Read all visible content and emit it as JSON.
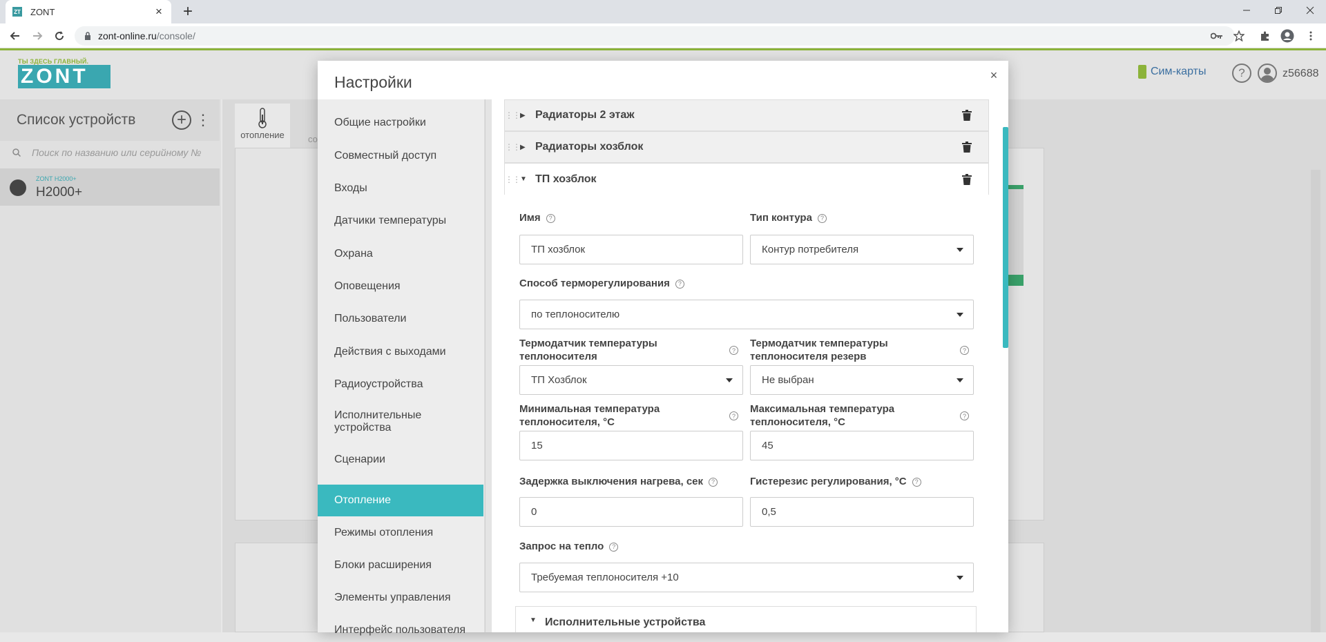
{
  "browser": {
    "tab_title": "ZONT",
    "favicon_text": "ZT",
    "url_host": "zont-online.ru",
    "url_path": "/console/"
  },
  "header": {
    "logo_tagline": "ТЫ ЗДЕСЬ ГЛАВНЫЙ.",
    "logo_text": "ZONT",
    "sim_label": "Сим-карты",
    "help_label": "?",
    "username": "z56688"
  },
  "left_panel": {
    "title": "Список устройств",
    "search_placeholder": "Поиск по названию или серийному №",
    "device_sub": "ZONT H2000+",
    "device_name": "H2000+"
  },
  "device_tab": {
    "label": "отопление",
    "next_label": "со"
  },
  "modal": {
    "title": "Настройки",
    "close": "×",
    "menu": [
      "Общие настройки",
      "Совместный доступ",
      "Входы",
      "Датчики температуры",
      "Охрана",
      "Оповещения",
      "Пользователи",
      "Действия с выходами",
      "Радиоустройства",
      "Исполнительные устройства",
      "Сценарии",
      "Отопление",
      "Режимы отопления",
      "Блоки расширения",
      "Элементы управления",
      "Интерфейс пользователя"
    ],
    "active_menu": "Отопление",
    "circuits": [
      {
        "title": "Радиаторы 2 этаж",
        "open": false
      },
      {
        "title": "Радиаторы хозблок",
        "open": false
      },
      {
        "title": "ТП хозблок",
        "open": true
      }
    ],
    "form": {
      "name_label": "Имя",
      "name_value": "ТП хозблок",
      "circuit_type_label": "Тип контура",
      "circuit_type_value": "Контур потребителя",
      "regulation_label": "Способ терморегулирования",
      "regulation_value": "по теплоносителю",
      "sensor_label_1": "Термодатчик температуры",
      "sensor_label_2": "теплоносителя",
      "sensor_value": "ТП Хозблок",
      "reserve_label_1": "Термодатчик температуры",
      "reserve_label_2": "теплоносителя резерв",
      "reserve_value": "Не выбран",
      "min_label_1": "Минимальная температура",
      "min_label_2": "теплоносителя, °С",
      "min_value": "15",
      "max_label_1": "Максимальная температура",
      "max_label_2": "теплоносителя, °С",
      "max_value": "45",
      "delay_label": "Задержка выключения нагрева, сек",
      "delay_value": "0",
      "hysteresis_label": "Гистерезис регулирования, °С",
      "hysteresis_value": "0,5",
      "heat_request_label": "Запрос на тепло",
      "heat_request_value": "Требуемая теплоносителя +10",
      "sub_section": "Исполнительные устройства"
    }
  },
  "colors": {
    "accent": "#3ab9bf",
    "brand_green": "#8cb33a",
    "brand_teal": "#3aa7b0"
  }
}
